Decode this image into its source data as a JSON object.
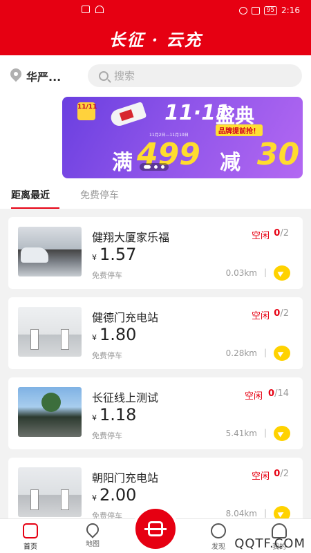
{
  "status_bar": {
    "time": "2:16",
    "battery": "95"
  },
  "app_title": "长征 · 云充",
  "location": {
    "city": "华严..."
  },
  "search": {
    "placeholder": "搜索"
  },
  "banner": {
    "tag": "11/11",
    "headline": "11·11",
    "festival": "盛典",
    "sub": "品牌提前抢！",
    "date": "11月2日—11月10日",
    "man": "满",
    "amount": "499",
    "jian": "减",
    "discount": "30"
  },
  "tabs": [
    {
      "label": "距离最近",
      "active": true
    },
    {
      "label": "免费停车",
      "active": false
    }
  ],
  "stations": [
    {
      "name": "健翔大厦家乐福",
      "currency": "¥",
      "price": "1.57",
      "parking": "免费停车",
      "status": "空闲",
      "available": "0",
      "total": "/2",
      "distance": "0.03km"
    },
    {
      "name": "健德门充电站",
      "currency": "¥",
      "price": "1.80",
      "parking": "免费停车",
      "status": "空闲",
      "available": "0",
      "total": "/2",
      "distance": "0.28km"
    },
    {
      "name": "长征线上测试",
      "currency": "¥",
      "price": "1.18",
      "parking": "免费停车",
      "status": "空闲",
      "available": "0",
      "total": "/14",
      "distance": "5.41km"
    },
    {
      "name": "朝阳门充电站",
      "currency": "¥",
      "price": "2.00",
      "parking": "免费停车",
      "status": "空闲",
      "available": "0",
      "total": "/2",
      "distance": "8.04km"
    }
  ],
  "bottom_nav": {
    "home": "首页",
    "map": "地图",
    "discover": "发现",
    "mine": "我的"
  },
  "watermark": "QQTF.COM",
  "colors": {
    "brand_red": "#e60012",
    "nav_yellow": "#ffd200"
  }
}
